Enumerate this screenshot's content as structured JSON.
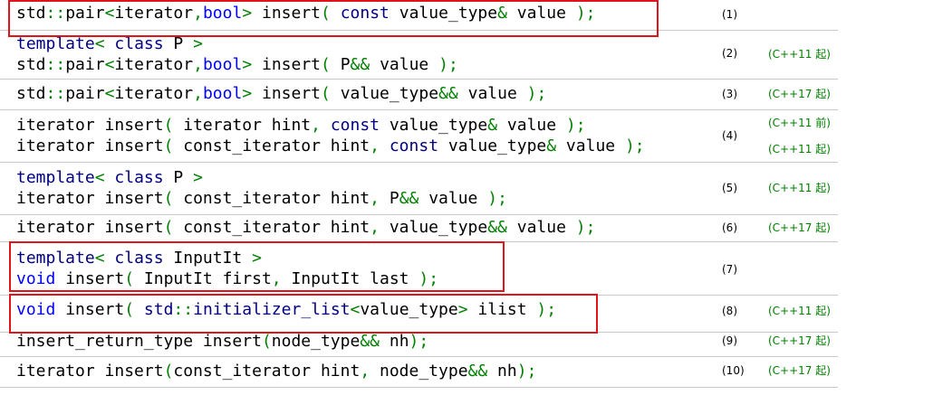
{
  "colors": {
    "keyword": "#000080",
    "type": "#0000ff",
    "symbol": "#008000",
    "version": "#008000",
    "highlight": "#e0151c",
    "divider": "#c9c9c9"
  },
  "overloads": [
    {
      "num": "(1)",
      "lines": [
        [
          {
            "t": "std"
          },
          {
            "t": "::",
            "c": "sym"
          },
          {
            "t": "pair"
          },
          {
            "t": "<",
            "c": "sym"
          },
          {
            "t": "iterator"
          },
          {
            "t": ",",
            "c": "sym"
          },
          {
            "t": "bool",
            "c": "tp"
          },
          {
            "t": ">",
            "c": "sym"
          },
          {
            "t": " insert"
          },
          {
            "t": "(",
            "c": "sym"
          },
          {
            "t": " "
          },
          {
            "t": "const",
            "c": "kw"
          },
          {
            "t": " value_type"
          },
          {
            "t": "&",
            "c": "sym"
          },
          {
            "t": " value "
          },
          {
            "t": ")",
            "c": "sym"
          },
          {
            "t": ";",
            "c": "sym"
          }
        ]
      ]
    },
    {
      "num": "(2)",
      "vers": [
        "(C++11 起)"
      ],
      "lines": [
        [
          {
            "t": "template",
            "c": "kw"
          },
          {
            "t": "<",
            "c": "sym"
          },
          {
            "t": " "
          },
          {
            "t": "class",
            "c": "kw"
          },
          {
            "t": " P "
          },
          {
            "t": ">",
            "c": "sym"
          }
        ],
        [
          {
            "t": "std"
          },
          {
            "t": "::",
            "c": "sym"
          },
          {
            "t": "pair"
          },
          {
            "t": "<",
            "c": "sym"
          },
          {
            "t": "iterator"
          },
          {
            "t": ",",
            "c": "sym"
          },
          {
            "t": "bool",
            "c": "tp"
          },
          {
            "t": ">",
            "c": "sym"
          },
          {
            "t": " insert"
          },
          {
            "t": "(",
            "c": "sym"
          },
          {
            "t": " P"
          },
          {
            "t": "&&",
            "c": "sym"
          },
          {
            "t": " value "
          },
          {
            "t": ")",
            "c": "sym"
          },
          {
            "t": ";",
            "c": "sym"
          }
        ]
      ]
    },
    {
      "num": "(3)",
      "vers": [
        "(C++17 起)"
      ],
      "lines": [
        [
          {
            "t": "std"
          },
          {
            "t": "::",
            "c": "sym"
          },
          {
            "t": "pair"
          },
          {
            "t": "<",
            "c": "sym"
          },
          {
            "t": "iterator"
          },
          {
            "t": ",",
            "c": "sym"
          },
          {
            "t": "bool",
            "c": "tp"
          },
          {
            "t": ">",
            "c": "sym"
          },
          {
            "t": " insert"
          },
          {
            "t": "(",
            "c": "sym"
          },
          {
            "t": " value_type"
          },
          {
            "t": "&&",
            "c": "sym"
          },
          {
            "t": " value "
          },
          {
            "t": ")",
            "c": "sym"
          },
          {
            "t": ";",
            "c": "sym"
          }
        ]
      ]
    },
    {
      "num": "(4)",
      "vers": [
        "(C++11 前)",
        "(C++11 起)"
      ],
      "lines": [
        [
          {
            "t": "iterator insert"
          },
          {
            "t": "(",
            "c": "sym"
          },
          {
            "t": " iterator hint"
          },
          {
            "t": ",",
            "c": "sym"
          },
          {
            "t": " "
          },
          {
            "t": "const",
            "c": "kw"
          },
          {
            "t": " value_type"
          },
          {
            "t": "&",
            "c": "sym"
          },
          {
            "t": " value "
          },
          {
            "t": ")",
            "c": "sym"
          },
          {
            "t": ";",
            "c": "sym"
          }
        ],
        [
          {
            "t": "iterator insert"
          },
          {
            "t": "(",
            "c": "sym"
          },
          {
            "t": " const_iterator hint"
          },
          {
            "t": ",",
            "c": "sym"
          },
          {
            "t": " "
          },
          {
            "t": "const",
            "c": "kw"
          },
          {
            "t": " value_type"
          },
          {
            "t": "&",
            "c": "sym"
          },
          {
            "t": " value "
          },
          {
            "t": ")",
            "c": "sym"
          },
          {
            "t": ";",
            "c": "sym"
          }
        ]
      ]
    },
    {
      "num": "(5)",
      "vers": [
        "(C++11 起)"
      ],
      "lines": [
        [
          {
            "t": "template",
            "c": "kw"
          },
          {
            "t": "<",
            "c": "sym"
          },
          {
            "t": " "
          },
          {
            "t": "class",
            "c": "kw"
          },
          {
            "t": " P "
          },
          {
            "t": ">",
            "c": "sym"
          }
        ],
        [
          {
            "t": "iterator insert"
          },
          {
            "t": "(",
            "c": "sym"
          },
          {
            "t": " const_iterator hint"
          },
          {
            "t": ",",
            "c": "sym"
          },
          {
            "t": " P"
          },
          {
            "t": "&&",
            "c": "sym"
          },
          {
            "t": " value "
          },
          {
            "t": ")",
            "c": "sym"
          },
          {
            "t": ";",
            "c": "sym"
          }
        ]
      ]
    },
    {
      "num": "(6)",
      "vers": [
        "(C++17 起)"
      ],
      "lines": [
        [
          {
            "t": "iterator insert"
          },
          {
            "t": "(",
            "c": "sym"
          },
          {
            "t": " const_iterator hint"
          },
          {
            "t": ",",
            "c": "sym"
          },
          {
            "t": " value_type"
          },
          {
            "t": "&&",
            "c": "sym"
          },
          {
            "t": " value "
          },
          {
            "t": ")",
            "c": "sym"
          },
          {
            "t": ";",
            "c": "sym"
          }
        ]
      ]
    },
    {
      "num": "(7)",
      "lines": [
        [
          {
            "t": "template",
            "c": "kw"
          },
          {
            "t": "<",
            "c": "sym"
          },
          {
            "t": " "
          },
          {
            "t": "class",
            "c": "kw"
          },
          {
            "t": " InputIt "
          },
          {
            "t": ">",
            "c": "sym"
          }
        ],
        [
          {
            "t": "void",
            "c": "tp"
          },
          {
            "t": " insert"
          },
          {
            "t": "(",
            "c": "sym"
          },
          {
            "t": " InputIt first"
          },
          {
            "t": ",",
            "c": "sym"
          },
          {
            "t": " InputIt last "
          },
          {
            "t": ")",
            "c": "sym"
          },
          {
            "t": ";",
            "c": "sym"
          }
        ]
      ]
    },
    {
      "num": "(8)",
      "vers": [
        "(C++11 起)"
      ],
      "lines": [
        [
          {
            "t": "void",
            "c": "tp"
          },
          {
            "t": " insert"
          },
          {
            "t": "(",
            "c": "sym"
          },
          {
            "t": " "
          },
          {
            "t": "std",
            "c": "kw"
          },
          {
            "t": "::",
            "c": "sym"
          },
          {
            "t": "initializer_list",
            "c": "kw"
          },
          {
            "t": "<",
            "c": "sym"
          },
          {
            "t": "value_type"
          },
          {
            "t": ">",
            "c": "sym"
          },
          {
            "t": " ilist "
          },
          {
            "t": ")",
            "c": "sym"
          },
          {
            "t": ";",
            "c": "sym"
          }
        ]
      ]
    },
    {
      "num": "(9)",
      "vers": [
        "(C++17 起)"
      ],
      "lines": [
        [
          {
            "t": "insert_return_type insert"
          },
          {
            "t": "(",
            "c": "sym"
          },
          {
            "t": "node_type"
          },
          {
            "t": "&&",
            "c": "sym"
          },
          {
            "t": " nh"
          },
          {
            "t": ")",
            "c": "sym"
          },
          {
            "t": ";",
            "c": "sym"
          }
        ]
      ]
    },
    {
      "num": "(10)",
      "vers": [
        "(C++17 起)"
      ],
      "lines": [
        [
          {
            "t": "iterator insert"
          },
          {
            "t": "(",
            "c": "sym"
          },
          {
            "t": "const_iterator hint"
          },
          {
            "t": ",",
            "c": "sym"
          },
          {
            "t": " node_type"
          },
          {
            "t": "&&",
            "c": "sym"
          },
          {
            "t": " nh"
          },
          {
            "t": ")",
            "c": "sym"
          },
          {
            "t": ";",
            "c": "sym"
          }
        ]
      ]
    }
  ]
}
